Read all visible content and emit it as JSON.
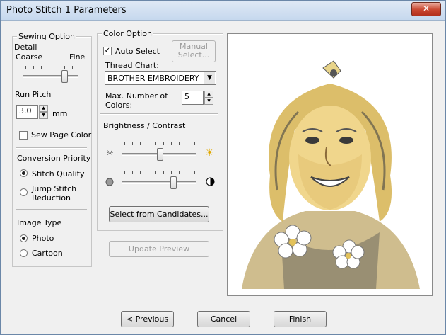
{
  "window": {
    "title": "Photo Stitch 1 Parameters",
    "close_glyph": "✕"
  },
  "sewing": {
    "legend": "Sewing Option",
    "detail_label": "Detail",
    "coarse_label": "Coarse",
    "fine_label": "Fine",
    "run_pitch_label": "Run Pitch",
    "run_pitch_value": "3.0",
    "run_pitch_unit": "mm",
    "sew_page_color_label": "Sew Page Color",
    "sew_page_color_checked": false,
    "conversion_priority_label": "Conversion Priority",
    "stitch_quality_label": "Stitch Quality",
    "jump_stitch_label_1": "Jump Stitch",
    "jump_stitch_label_2": "Reduction",
    "image_type_label": "Image Type",
    "photo_label": "Photo",
    "cartoon_label": "Cartoon"
  },
  "color": {
    "legend": "Color Option",
    "auto_select_label": "Auto Select",
    "auto_select_checked": true,
    "manual_select_label_1": "Manual",
    "manual_select_label_2": "Select...",
    "thread_chart_label": "Thread Chart:",
    "thread_chart_value": "BROTHER EMBROIDERY",
    "max_colors_label_1": "Max. Number of",
    "max_colors_label_2": "Colors:",
    "max_colors_value": "5",
    "brightness_contrast_label": "Brightness / Contrast",
    "select_candidates_label": "Select from Candidates..."
  },
  "update_preview_label": "Update Preview",
  "footer": {
    "previous_label": "< Previous",
    "cancel_label": "Cancel",
    "finish_label": "Finish"
  }
}
